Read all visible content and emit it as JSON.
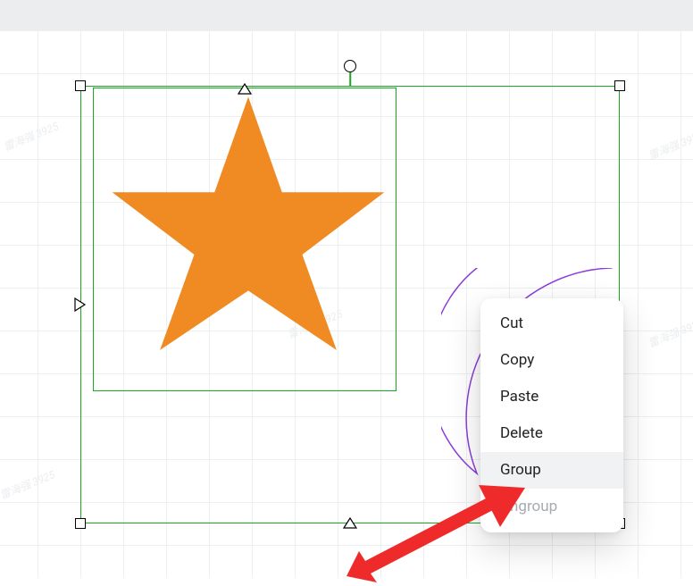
{
  "canvas": {
    "shapes": {
      "star_fill": "#f08a22",
      "moon_stroke": "#8a3dd8"
    },
    "selection_color": "#18a821",
    "watermark_text": "雷海强 3925",
    "annotation_arrow_color": "#ef2a2a"
  },
  "context_menu": {
    "items": [
      {
        "label": "Cut",
        "enabled": true,
        "hover": false
      },
      {
        "label": "Copy",
        "enabled": true,
        "hover": false
      },
      {
        "label": "Paste",
        "enabled": true,
        "hover": false
      },
      {
        "label": "Delete",
        "enabled": true,
        "hover": false
      },
      {
        "label": "Group",
        "enabled": true,
        "hover": true
      },
      {
        "label": "Ungroup",
        "enabled": false,
        "hover": false
      }
    ]
  }
}
